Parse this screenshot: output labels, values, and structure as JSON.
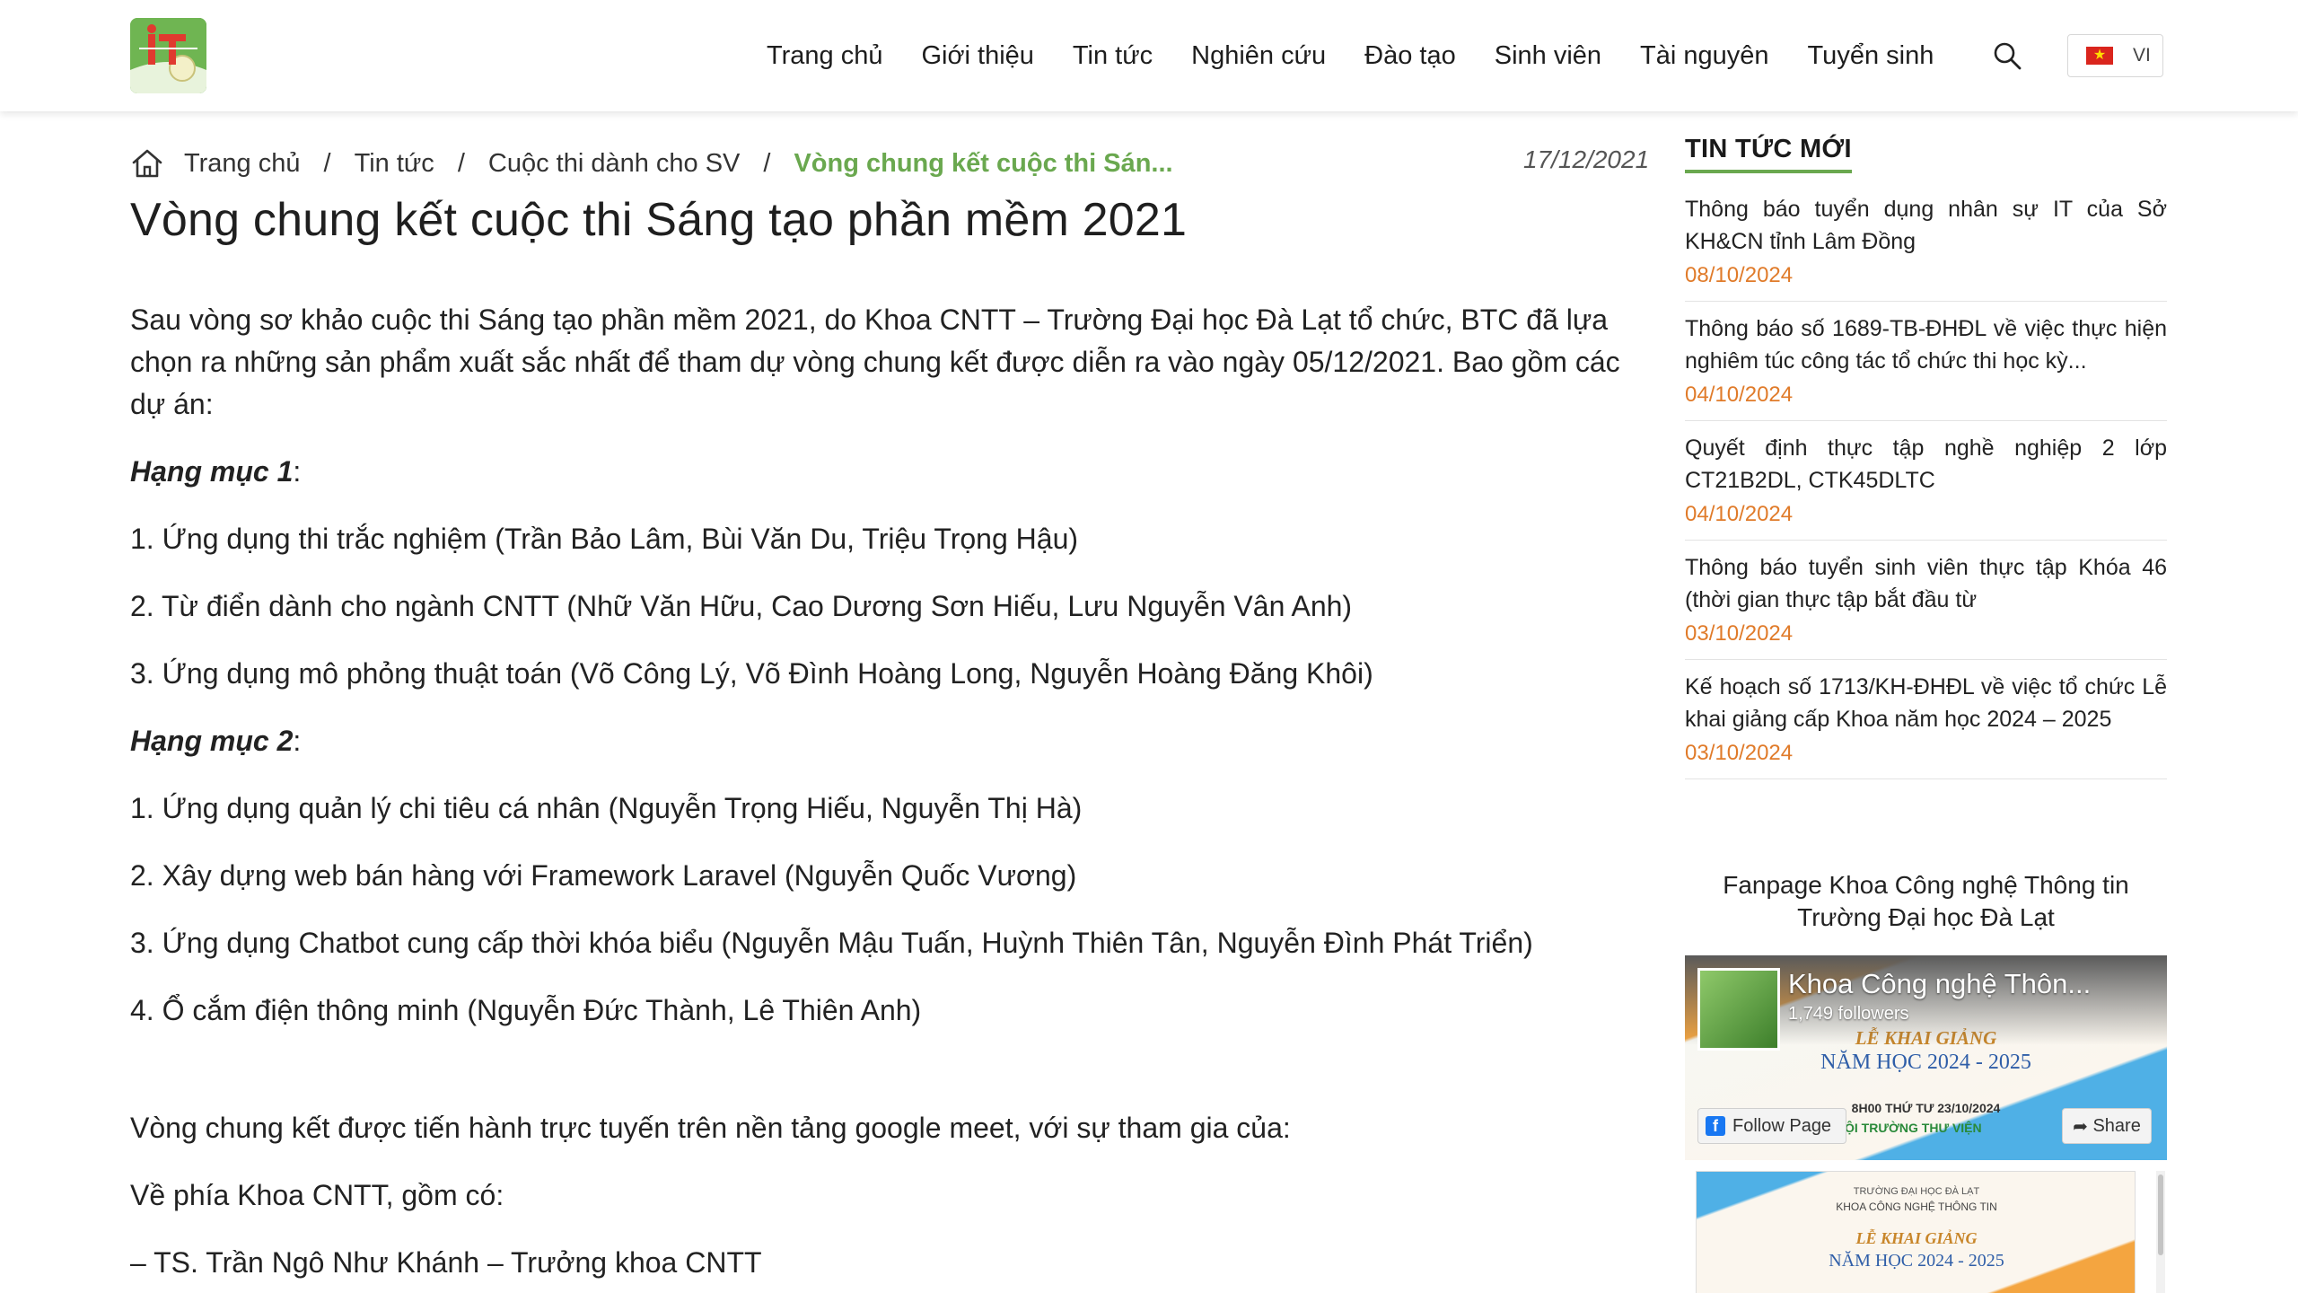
{
  "header": {
    "logo_text": "IT",
    "nav": [
      "Trang chủ",
      "Giới thiệu",
      "Tin tức",
      "Nghiên cứu",
      "Đào tạo",
      "Sinh viên",
      "Tài nguyên",
      "Tuyển sinh"
    ],
    "search_icon": "search-icon",
    "language": "VI"
  },
  "breadcrumb": {
    "items": [
      "Trang chủ",
      "Tin tức",
      "Cuộc thi dành cho SV"
    ],
    "current": "Vòng chung kết cuộc thi Sán...",
    "separator": "/"
  },
  "article": {
    "date": "17/12/2021",
    "title": "Vòng chung kết cuộc thi Sáng tạo phần mềm 2021",
    "intro": "Sau vòng sơ khảo cuộc thi Sáng tạo phần mềm 2021, do Khoa CNTT – Trường Đại học Đà Lạt tổ chức, BTC đã lựa chọn ra những sản phẩm xuất sắc nhất để tham dự vòng chung kết được diễn ra vào ngày 05/12/2021. Bao gồm các dự án:",
    "category1": {
      "label": "Hạng mục 1",
      "items": [
        "1. Ứng dụng thi trắc nghiệm (Trần Bảo Lâm, Bùi Văn Du, Triệu Trọng Hậu)",
        "2. Từ điển dành cho ngành CNTT (Nhữ Văn Hữu, Cao Dương Sơn Hiếu, Lưu Nguyễn Vân Anh)",
        "3. Ứng dụng mô phỏng thuật toán (Võ Công Lý, Võ Đình Hoàng Long, Nguyễn Hoàng Đăng Khôi)"
      ]
    },
    "category2": {
      "label": "Hạng mục 2",
      "items": [
        "1. Ứng dụng quản lý chi tiêu cá nhân (Nguyễn Trọng Hiếu, Nguyễn Thị Hà)",
        "2. Xây dựng web bán hàng với Framework Laravel (Nguyễn Quốc Vương)",
        "3. Ứng dụng Chatbot cung cấp thời khóa biểu (Nguyễn Mậu Tuấn, Huỳnh Thiên Tân, Nguyễn Đình Phát Triển)",
        "4. Ổ cắm điện thông minh (Nguyễn Đức Thành, Lê Thiên Anh)"
      ]
    },
    "final_round": "Vòng chung kết được tiến hành trực tuyến trên nền tảng google meet, với sự tham gia của:",
    "faculty_side": "Về phía Khoa CNTT, gồm có:",
    "member1": "– TS. Trần Ngô Như Khánh – Trưởng khoa CNTT"
  },
  "sidebar": {
    "heading": "TIN TỨC MỚI",
    "news": [
      {
        "title": "Thông báo tuyển dụng nhân sự IT của Sở KH&CN tỉnh Lâm Đồng",
        "date": "08/10/2024"
      },
      {
        "title": "Thông báo số 1689-TB-ĐHĐL về việc thực hiện nghiêm túc công tác tổ chức thi học kỳ...",
        "date": "04/10/2024"
      },
      {
        "title": "Quyết định thực tập nghề nghiệp 2 lớp CT21B2DL, CTK45DLTC",
        "date": "04/10/2024"
      },
      {
        "title": "Thông báo tuyển sinh viên thực tập Khóa 46 (thời gian thực tập bắt đầu từ",
        "date": "03/10/2024"
      },
      {
        "title": "Kế hoạch số 1713/KH-ĐHĐL về việc tổ chức Lễ khai giảng cấp Khoa năm học 2024 – 2025",
        "date": "03/10/2024"
      }
    ],
    "fanpage_heading": "Fanpage Khoa Công nghệ Thông tin Trường Đại học Đà Lạt",
    "fb": {
      "page_name": "Khoa Công nghệ Thôn...",
      "followers": "1,749 followers",
      "follow_label": "Follow Page",
      "share_label": "Share",
      "event_title": "LỄ KHAI GIẢNG",
      "event_year": "NĂM HỌC 2024 - 2025",
      "event_time": "8H00  THỨ TƯ  23/10/2024",
      "event_place": "ỘI TRƯỜNG THƯ VIỆN",
      "post_school": "TRƯỜNG ĐẠI HỌC ĐÀ LẠT",
      "post_faculty": "KHOA CÔNG NGHỆ THÔNG TIN",
      "post_title": "LỄ KHAI GIẢNG",
      "post_year": "NĂM HỌC 2024 - 2025"
    }
  }
}
